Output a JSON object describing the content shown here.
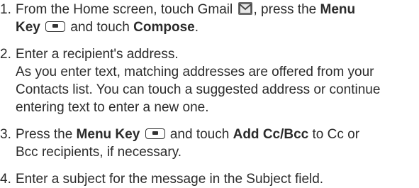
{
  "steps": [
    {
      "number": "1.",
      "t1": "From the Home screen, touch Gmail ",
      "icon1": "gmail-icon",
      "t2": ", press the ",
      "b1": "Menu",
      "t3": "Key ",
      "icon2": "menu-key-icon",
      "t4": " and touch ",
      "b2": "Compose",
      "t5": "."
    },
    {
      "number": "2.",
      "line1": "Enter a recipient's address.",
      "line2": "As you enter text, matching addresses are offered from your",
      "line3": "Contacts list. You can touch a suggested address or continue",
      "line4": "entering text to enter a new one."
    },
    {
      "number": "3.",
      "t1": "Press the ",
      "b1": "Menu Key",
      "icon1": "menu-key-icon",
      "t2": " and touch ",
      "b2": "Add Cc/Bcc",
      "t3": " to Cc or",
      "t4": "Bcc recipients, if necessary."
    },
    {
      "number": "4.",
      "text": "Enter a subject for the message in the Subject field."
    }
  ]
}
